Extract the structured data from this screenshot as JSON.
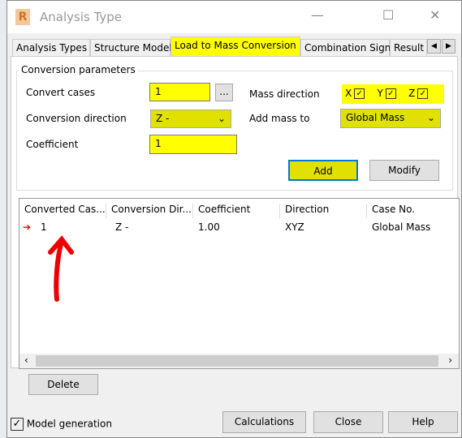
{
  "window": {
    "title": "Analysis Type",
    "minimize": "—",
    "maximize": "☐",
    "close": "✕",
    "logo": "R"
  },
  "tabs": [
    {
      "label": "Analysis Types"
    },
    {
      "label": "Structure Model"
    },
    {
      "label": "Load to Mass Conversion",
      "active": true
    },
    {
      "label": "Combination Sign"
    },
    {
      "label": "Result"
    }
  ],
  "tab_scroll": {
    "left": "◀",
    "right": "▶"
  },
  "params": {
    "group_label": "Conversion parameters",
    "convert_cases_label": "Convert cases",
    "convert_cases_value": "1",
    "browse_label": "...",
    "conversion_direction_label": "Conversion direction",
    "conversion_direction_value": "Z -",
    "coefficient_label": "Coefficient",
    "coefficient_value": "1",
    "mass_direction_label": "Mass direction",
    "x_label": "X",
    "y_label": "Y",
    "z_label": "Z",
    "x_checked": true,
    "y_checked": true,
    "z_checked": true,
    "add_mass_to_label": "Add mass to",
    "add_mass_to_value": "Global Mass",
    "add_label": "Add",
    "modify_label": "Modify"
  },
  "table": {
    "headers": [
      "Converted Cas...",
      "Conversion Dir...",
      "Coefficient",
      "Direction",
      "Case No."
    ],
    "rows": [
      [
        "1",
        "Z -",
        "1.00",
        "XYZ",
        "Global Mass"
      ]
    ]
  },
  "delete_label": "Delete",
  "footer": {
    "model_generation_label": "Model generation",
    "model_generation_checked": true,
    "calculations_label": "Calculations",
    "close_label": "Close",
    "help_label": "Help"
  },
  "highlight_color": "#ffff00"
}
